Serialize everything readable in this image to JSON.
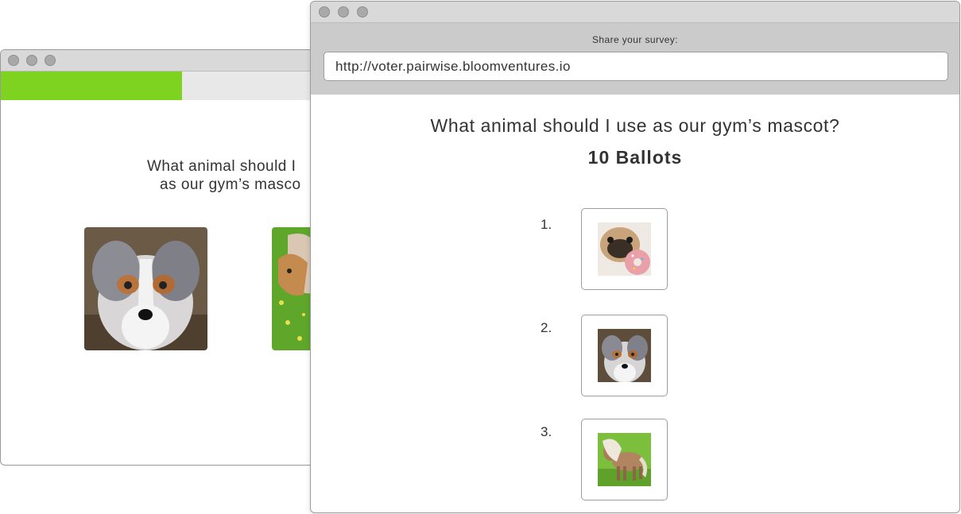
{
  "back_window": {
    "progress_fraction": 0.545,
    "question_line1": "What animal should I",
    "question_line2": "as our gym’s masco",
    "images": [
      {
        "icon": "dog-photo",
        "alt": "Australian shepherd puppy"
      },
      {
        "icon": "pony-photo",
        "alt": "Pony"
      }
    ]
  },
  "front_window": {
    "share_label": "Share your survey:",
    "share_url": "http://voter.pairwise.bloomventures.io",
    "title": "What animal should I use as our gym’s mascot?",
    "ballots": "10 Ballots",
    "rankings": [
      {
        "rank": "1.",
        "icon": "pug-photo"
      },
      {
        "rank": "2.",
        "icon": "dog-photo"
      },
      {
        "rank": "3.",
        "icon": "pony-photo"
      }
    ]
  },
  "colors": {
    "progress_fill": "#7ed321",
    "progress_track": "#e8e8e8",
    "share_bar": "#cbcbcb"
  }
}
